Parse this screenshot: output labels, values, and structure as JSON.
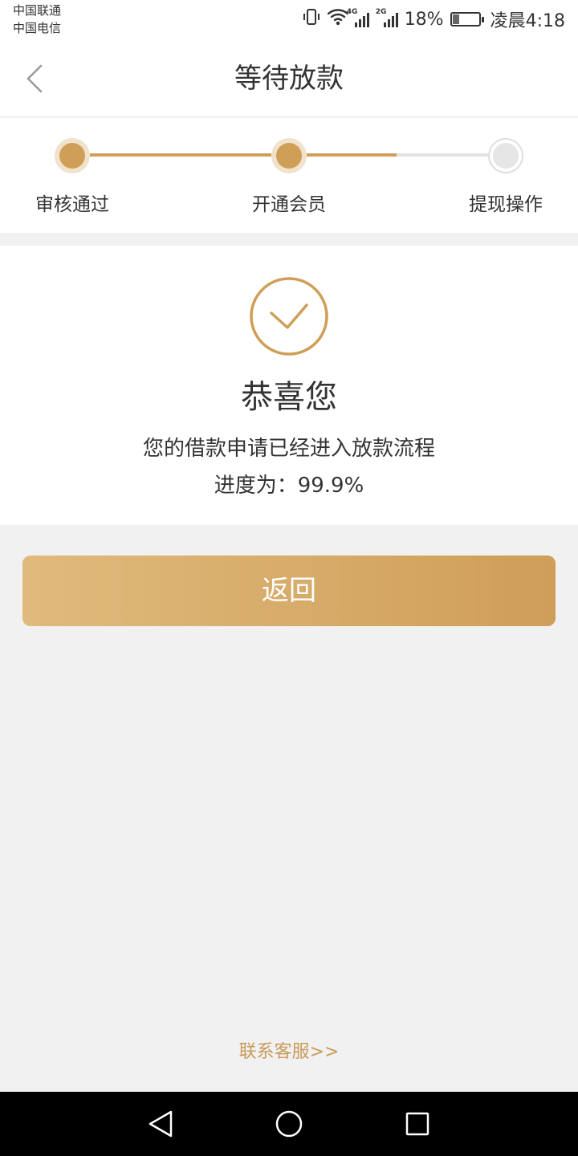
{
  "status_bar": {
    "carrier_1": "中国联通",
    "carrier_2": "中国电信",
    "network_1": "4G",
    "network_2": "2G",
    "battery": "18%",
    "time": "凌晨4:18",
    "icons": [
      "vibrate-icon",
      "wifi-icon",
      "signal-4g-icon",
      "signal-2g-icon",
      "battery-icon"
    ]
  },
  "header": {
    "title": "等待放款",
    "back_icon": "chevron-left-icon"
  },
  "steps": [
    {
      "label": "审核通过",
      "status": "done"
    },
    {
      "label": "开通会员",
      "status": "done"
    },
    {
      "label": "提现操作",
      "status": "pending"
    }
  ],
  "result": {
    "icon": "check-circle-icon",
    "title": "恭喜您",
    "message": "您的借款申请已经进入放款流程",
    "progress_prefix": "进度为：",
    "progress_value": "99.9%"
  },
  "actions": {
    "return_label": "返回",
    "contact_label": "联系客服>>"
  },
  "colors": {
    "accent": "#cf9f58",
    "button_gradient_start": "#e0ba7c",
    "button_gradient_end": "#cf9e58",
    "link": "#c99a5a",
    "pending": "#e1e1e1"
  },
  "nav_bar": {
    "icons": [
      "nav-back-icon",
      "nav-home-icon",
      "nav-recents-icon"
    ]
  }
}
